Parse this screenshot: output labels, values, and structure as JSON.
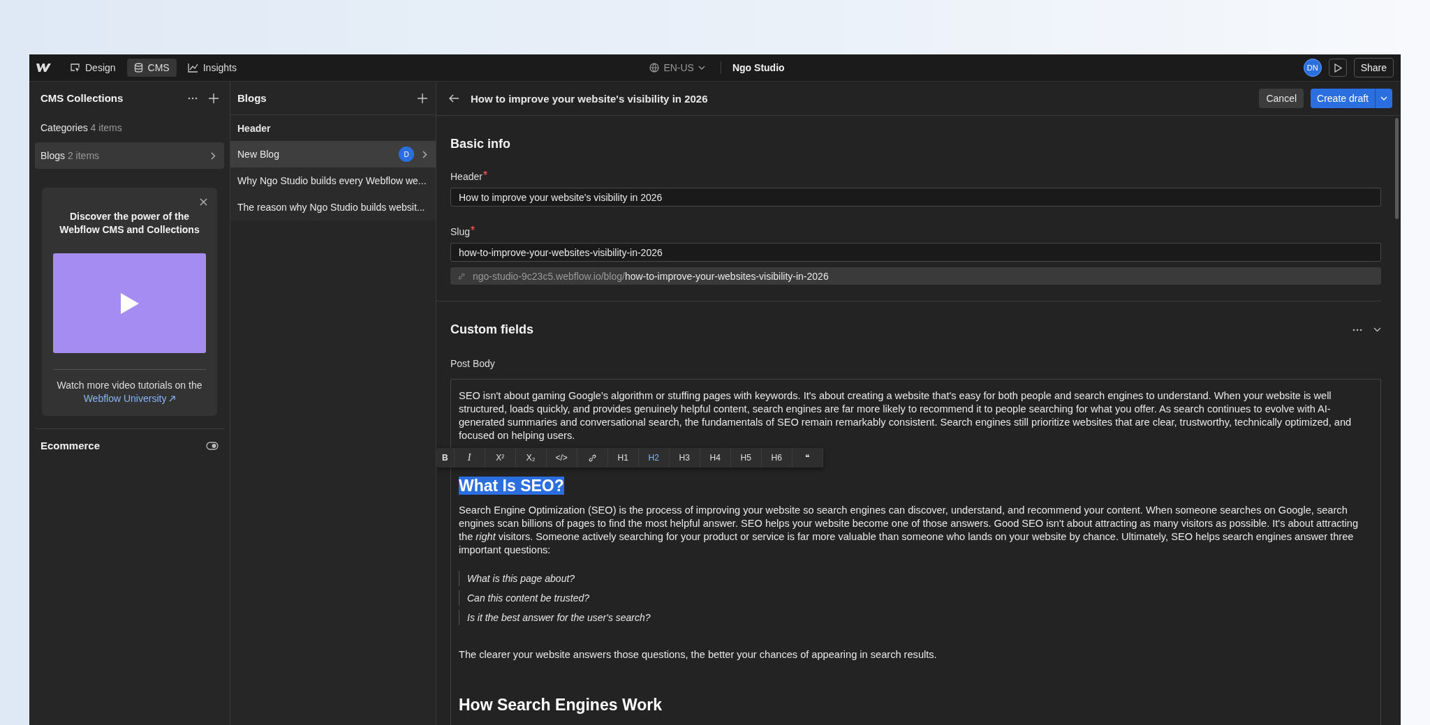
{
  "topbar": {
    "tabs": [
      {
        "label": "Design",
        "selected": false
      },
      {
        "label": "CMS",
        "selected": true
      },
      {
        "label": "Insights",
        "selected": false
      }
    ],
    "locale": "EN-US",
    "site_name": "Ngo Studio",
    "avatar": "DN",
    "share": "Share"
  },
  "collections": {
    "title": "CMS Collections",
    "items": [
      {
        "name": "Categories",
        "count": "4 items",
        "selected": false
      },
      {
        "name": "Blogs",
        "count": "2 items",
        "selected": true
      }
    ],
    "promo": {
      "title": "Discover the power of the Webflow CMS and Collections",
      "caption": "Watch more video tutorials on the",
      "link": "Webflow University"
    },
    "ecommerce": "Ecommerce"
  },
  "blogs": {
    "title": "Blogs",
    "column": "Header",
    "items": [
      {
        "title": "New Blog",
        "badge": "D",
        "selected": true
      },
      {
        "title": "Why Ngo Studio builds every Webflow we...",
        "selected": false
      },
      {
        "title": "The reason why Ngo Studio builds websit...",
        "selected": false
      }
    ]
  },
  "editor": {
    "title": "How to improve your website's visibility in 2026",
    "cancel": "Cancel",
    "create": "Create draft",
    "basic_info": {
      "title": "Basic info",
      "fields": [
        {
          "label": "Header",
          "required": true,
          "value": "How to improve your website's visibility in 2026"
        },
        {
          "label": "Slug",
          "required": true,
          "value": "how-to-improve-your-websites-visibility-in-2026"
        }
      ],
      "url_base": "ngo-studio-9c23c5.webflow.io/blog/",
      "url_slug": "how-to-improve-your-websites-visibility-in-2026"
    },
    "custom_fields": {
      "title": "Custom fields",
      "post_body": {
        "label": "Post Body",
        "toolbar": [
          {
            "kind": "text",
            "label": "B",
            "selected": false
          },
          {
            "kind": "text",
            "label": "I",
            "selected": false
          },
          {
            "kind": "text",
            "label": "X²",
            "selected": false
          },
          {
            "kind": "text",
            "label": "X₂",
            "selected": false
          },
          {
            "kind": "text",
            "label": "</>",
            "selected": false
          },
          {
            "kind": "link",
            "selected": false
          },
          {
            "kind": "text",
            "label": "H1",
            "selected": false
          },
          {
            "kind": "text",
            "label": "H2",
            "selected": true
          },
          {
            "kind": "text",
            "label": "H3",
            "selected": false
          },
          {
            "kind": "text",
            "label": "H4",
            "selected": false
          },
          {
            "kind": "text",
            "label": "H5",
            "selected": false
          },
          {
            "kind": "text",
            "label": "H6",
            "selected": false
          },
          {
            "kind": "text",
            "label": "❝",
            "selected": false
          }
        ],
        "blocks": [
          {
            "kind": "paragraph",
            "text": "SEO isn't about gaming Google's algorithm or stuffing pages with keywords. It's about creating a website that's easy for both people and search engines to understand. When your website is well structured, loads quickly, and provides genuinely helpful content, search engines are far more likely to recommend it to people searching for what you offer. As search continues to evolve with AI-generated summaries and conversational search, the fundamentals of SEO remain remarkably consistent. Search engines still prioritize websites that are clear, trustworthy, technically optimized, and focused on helping users."
          },
          {
            "kind": "heading",
            "text": "What Is SEO?",
            "highlighted": true
          },
          {
            "kind": "paragraph",
            "text": "Search Engine Optimization (SEO) is the process of improving your website so search engines can discover, understand, and recommend your content. When someone searches on Google, search engines scan billions of pages to find the most helpful answer. SEO helps your website become one of those answers. Good SEO isn't about attracting as many visitors as possible.  It's about attracting the *right* visitors. Someone actively searching for your product or service is far more valuable than someone who lands on your website by chance. Ultimately, SEO helps search engines answer three important questions:"
          },
          {
            "kind": "quote",
            "text": "What is this page about?"
          },
          {
            "kind": "quote",
            "text": "Can this content be trusted?"
          },
          {
            "kind": "quote",
            "text": "Is it the best answer for the user's search?"
          },
          {
            "kind": "paragraph",
            "text": "The clearer your website answers those questions, the better your chances of appearing in search results."
          },
          {
            "kind": "heading",
            "text": "How Search Engines Work",
            "highlighted": false
          }
        ]
      }
    }
  }
}
